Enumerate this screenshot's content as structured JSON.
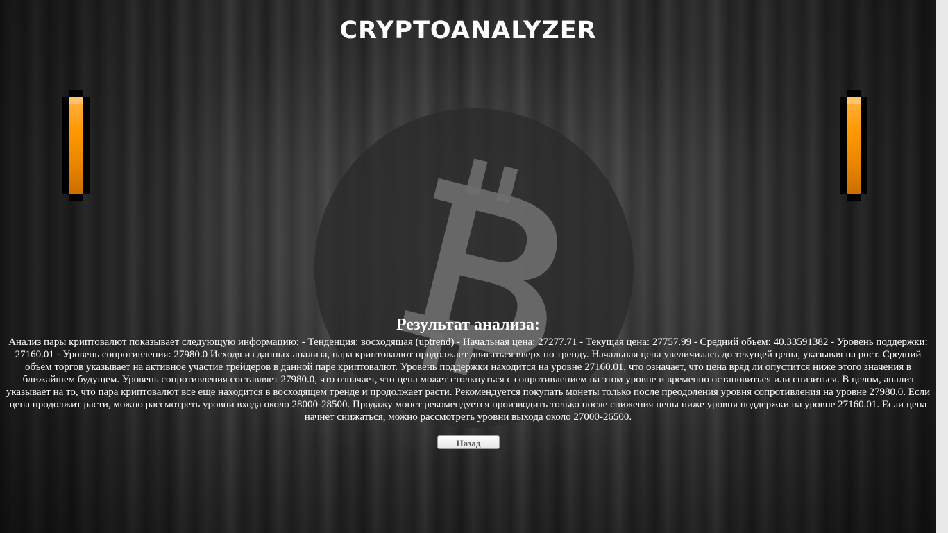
{
  "header": {
    "title": "CRYPTOANALYZER"
  },
  "decor": {
    "coin_icon": "bitcoin-icon",
    "side_bar_icon": "orange-pixel-bar",
    "accent_color": "#ff9800",
    "background": "dark-wood"
  },
  "result": {
    "heading": "Результат анализа:",
    "text": "Анализ пары криптовалют показывает следующую информацию: - Тенденция: восходящая (uptrend) - Начальная цена: 27277.71 - Текущая цена: 27757.99 - Средний объем: 40.33591382 - Уровень поддержки: 27160.01 - Уровень сопротивления: 27980.0 Исходя из данных анализа, пара криптовалют продолжает двигаться вверх по тренду. Начальная цена увеличилась до текущей цены, указывая на рост. Средний объем торгов указывает на активное участие трейдеров в данной паре криптовалют. Уровень поддержки находится на уровне 27160.01, что означает, что цена вряд ли опустится ниже этого значения в ближайшем будущем. Уровень сопротивления составляет 27980.0, что означает, что цена может столкнуться с сопротивлением на этом уровне и временно остановиться или снизиться. В целом, анализ указывает на то, что пара криптовалют все еще находится в восходящем тренде и продолжает расти. Рекомендуется покупать монеты только после преодоления уровня сопротивления на уровне 27980.0. Если цена продолжит расти, можно рассмотреть уровни входа около 28000-28500. Продажу монет рекомендуется производить только после снижения цены ниже уровня поддержки на уровне 27160.01. Если цена начнет снижаться, можно рассмотреть уровни выхода около 27000-26500."
  },
  "actions": {
    "back_label": "Назад"
  }
}
